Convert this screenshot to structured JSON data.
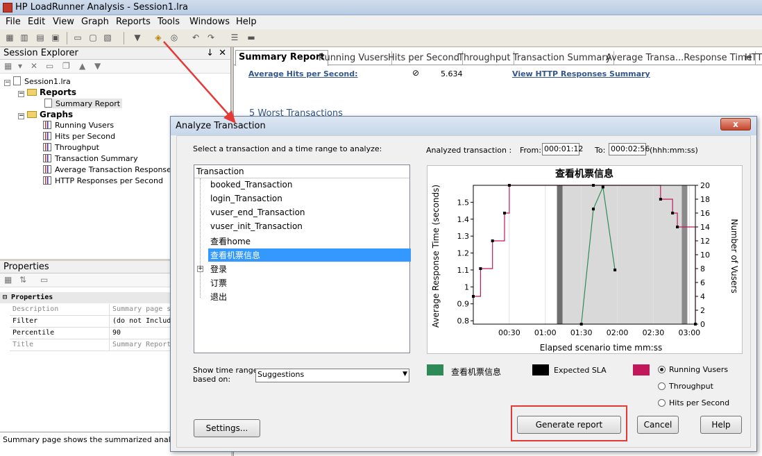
{
  "app": {
    "title": "HP LoadRunner Analysis - Session1.lra"
  },
  "menu": [
    "File",
    "Edit",
    "View",
    "Graph",
    "Reports",
    "Tools",
    "Windows",
    "Help"
  ],
  "session_explorer": {
    "title": "Session Explorer",
    "pin": "↓",
    "close": "✕",
    "root": "Session1.lra",
    "reports_label": "Reports",
    "summary_report": "Summary Report",
    "graphs_label": "Graphs",
    "graphs": [
      "Running Vusers",
      "Hits per Second",
      "Throughput",
      "Transaction Summary",
      "Average Transaction Response Time",
      "HTTP Responses per Second"
    ]
  },
  "properties": {
    "title": "Properties",
    "section": "Properties",
    "rows": [
      {
        "key": "Description",
        "value": "Summary page s"
      },
      {
        "key": "Filter",
        "value": "(do not Includ"
      },
      {
        "key": "Percentile",
        "value": "90"
      },
      {
        "key": "Title",
        "value": "Summary Report"
      }
    ],
    "description": "Summary page shows the summarized analysis on a"
  },
  "report": {
    "tabs": [
      "Summary Report",
      "Running Vusers",
      "Hits per Second",
      "Throughput",
      "Transaction Summary",
      "Average Transa...Response Time",
      "HTTP"
    ],
    "avg_hits_label": "Average Hits per Second:",
    "avg_hits_value": "5.634",
    "http_link": "View HTTP Responses Summary",
    "worst_heading": "5 Worst Transactions"
  },
  "dialog": {
    "title": "Analyze Transaction",
    "close": "x",
    "select_prompt": "Select a transaction and a time range to analyze:",
    "analyzed_label": "Analyzed transaction :",
    "from_label": "From:",
    "from_value": "000:01:12",
    "to_label": "To:",
    "to_value": "000:02:56",
    "time_format": "(hhh:mm:ss)",
    "list_header": "Transaction",
    "transactions": [
      "booked_Transaction",
      "login_Transaction",
      "vuser_end_Transaction",
      "vuser_init_Transaction",
      "查看home",
      "查看机票信息",
      "登录",
      "订票",
      "退出"
    ],
    "selected_index": 5,
    "show_ranges_label": "Show time ranges\nbased on:",
    "suggestions_value": "Suggestions",
    "legend": {
      "txn": "查看机票信息",
      "sla": "Expected SLA"
    },
    "radios": [
      "Running Vusers",
      "Throughput",
      "Hits per Second"
    ],
    "radio_selected": 0,
    "buttons": {
      "settings": "Settings...",
      "generate": "Generate report",
      "cancel": "Cancel",
      "help": "Help"
    }
  },
  "colors": {
    "txn": "#2e8b57",
    "sla": "#000000",
    "vusers": "#c2185b",
    "highlight": "#e53935",
    "link": "#34568b"
  },
  "chart_data": {
    "type": "line",
    "title": "查看机票信息",
    "xlabel": "Elapsed scenario time mm:ss",
    "ylabel": "Average Response Time (seconds)",
    "y2label": "Number of Vusers",
    "x_ticks": [
      "00:30",
      "01:00",
      "01:30",
      "02:00",
      "02:30",
      "03:00"
    ],
    "y_ticks": [
      "0.8",
      "0.9",
      "1",
      "1.1",
      "1.2",
      "1.3",
      "1.4",
      "1.5"
    ],
    "y2_ticks": [
      "0",
      "2",
      "4",
      "6",
      "8",
      "10",
      "12",
      "14",
      "16",
      "18",
      "20"
    ],
    "xlim": [
      0,
      185
    ],
    "ylim": [
      0.78,
      1.6
    ],
    "y2lim": [
      0,
      20
    ],
    "selected_range": [
      72,
      176
    ],
    "series": [
      {
        "name": "查看机票信息",
        "axis": "left",
        "x": [
          90,
          100,
          108,
          118
        ],
        "y": [
          0.78,
          1.46,
          1.59,
          1.1
        ]
      },
      {
        "name": "Running Vusers",
        "axis": "right",
        "step": true,
        "x": [
          0,
          6,
          16,
          26,
          30,
          100,
          156,
          166,
          170,
          185
        ],
        "y": [
          4,
          8,
          12,
          16,
          20,
          20,
          18,
          16,
          14,
          0
        ]
      }
    ]
  }
}
